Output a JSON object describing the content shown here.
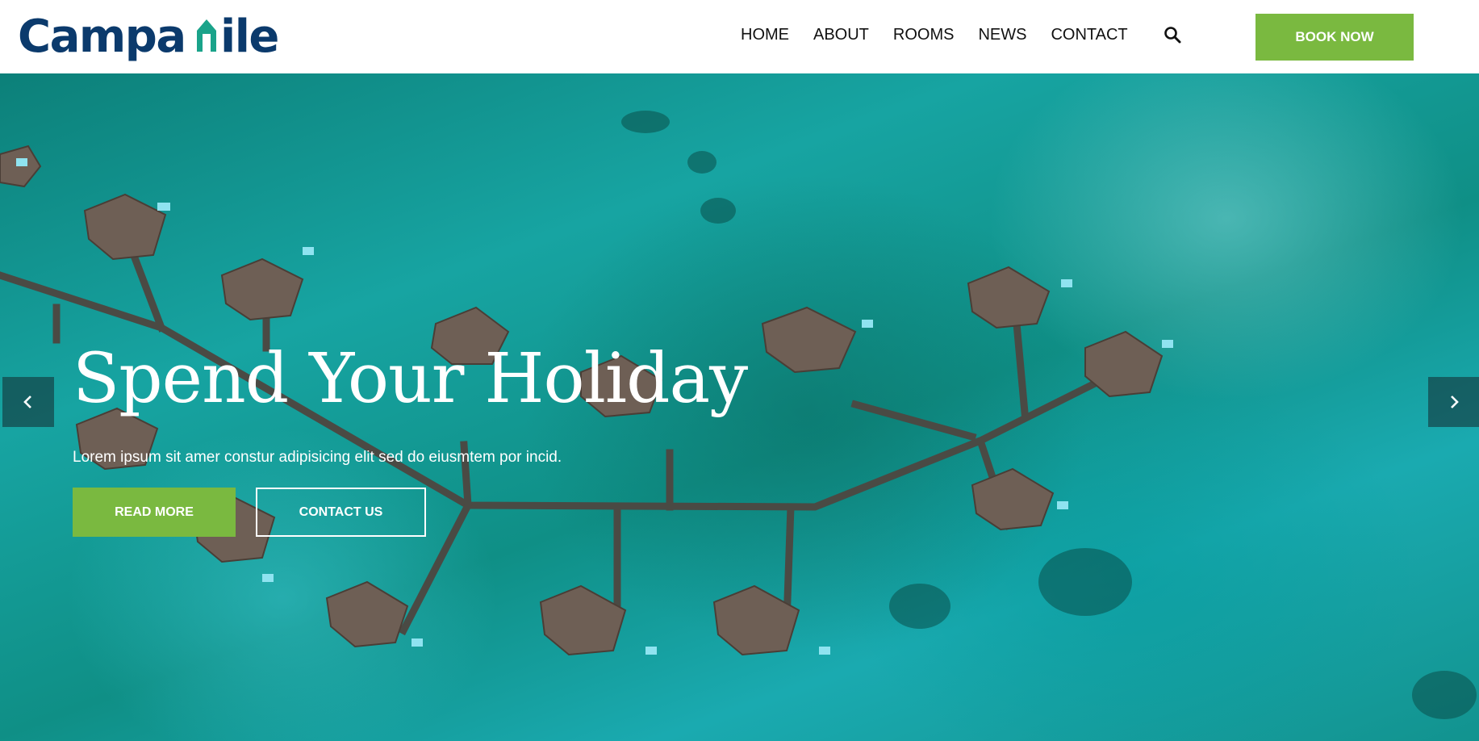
{
  "brand": {
    "name": "Campanile",
    "name_before": "Campa",
    "name_after": "ile",
    "primary_color": "#0b3a6c",
    "accent_color": "#1aa38a"
  },
  "nav": {
    "items": [
      {
        "label": "HOME"
      },
      {
        "label": "ABOUT"
      },
      {
        "label": "ROOMS"
      },
      {
        "label": "NEWS"
      },
      {
        "label": "CONTACT"
      }
    ],
    "search_icon": "search-icon",
    "book_label": "BOOK NOW",
    "book_color": "#7ab940"
  },
  "hero": {
    "title": "Spend Your Holiday",
    "subtitle": "Lorem ipsum sit amer constur adipisicing elit sed do eiusmtem por incid.",
    "read_more_label": "READ MORE",
    "contact_label": "CONTACT US",
    "prev_icon": "chevron-left-icon",
    "next_icon": "chevron-right-icon"
  }
}
